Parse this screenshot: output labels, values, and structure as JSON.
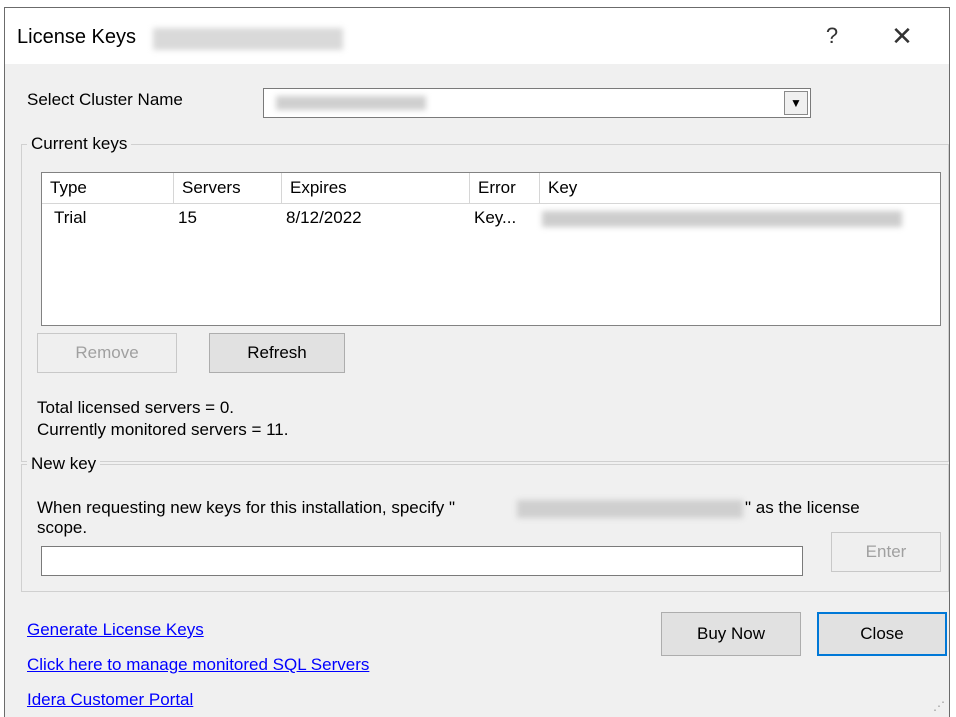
{
  "window": {
    "title": "License Keys",
    "help_label": "?",
    "close_label": "✕"
  },
  "cluster": {
    "label": "Select Cluster Name",
    "dropdown_arrow": "▼"
  },
  "current_keys": {
    "legend": "Current keys",
    "columns": [
      "Type",
      "Servers",
      "Expires",
      "Error",
      "Key"
    ],
    "rows": [
      {
        "type": "Trial",
        "servers": "15",
        "expires": "8/12/2022",
        "error": "Key..."
      }
    ],
    "remove_label": "Remove",
    "refresh_label": "Refresh",
    "total_licensed": "Total licensed servers = 0.",
    "currently_monitored": "Currently monitored servers = 11."
  },
  "new_key": {
    "legend": "New key",
    "instruction_prefix": "When requesting new keys for this installation, specify \"",
    "instruction_suffix": "\" as the license",
    "instruction_line2": "scope.",
    "enter_label": "Enter"
  },
  "footer": {
    "links": [
      "Generate License Keys",
      "Click here to manage monitored SQL Servers",
      "Idera Customer Portal"
    ],
    "buy_now_label": "Buy Now",
    "close_label": "Close"
  },
  "colors": {
    "link": "#0000ff",
    "dialog_bg": "#f0f0f0",
    "accent_focus": "#0078d7"
  }
}
